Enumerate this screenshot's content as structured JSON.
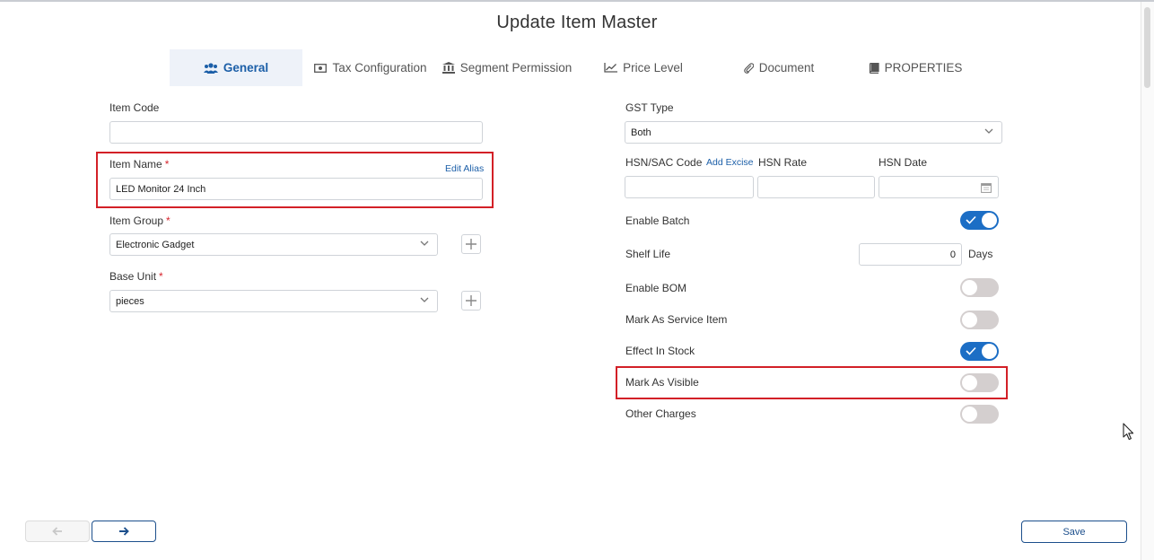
{
  "page": {
    "title": "Update Item Master"
  },
  "tabs": [
    {
      "label": "General",
      "icon": "users-icon",
      "active": true
    },
    {
      "label": "Tax Configuration",
      "icon": "money-icon"
    },
    {
      "label": "Segment Permission",
      "icon": "bank-icon"
    },
    {
      "label": "Price Level",
      "icon": "line-chart-icon"
    },
    {
      "label": "Document",
      "icon": "paperclip-icon"
    },
    {
      "label": "PROPERTIES",
      "icon": "book-icon"
    }
  ],
  "left": {
    "item_code": {
      "label": "Item Code",
      "value": ""
    },
    "item_name": {
      "label": "Item Name",
      "required": "*",
      "value": "LED Monitor 24 Inch",
      "edit_alias": "Edit Alias"
    },
    "item_group": {
      "label": "Item Group",
      "required": "*",
      "value": "Electronic Gadget"
    },
    "base_unit": {
      "label": "Base Unit",
      "required": "*",
      "value": "pieces"
    }
  },
  "right": {
    "gst_type": {
      "label": "GST Type",
      "value": "Both"
    },
    "hsn_sac_code": {
      "label": "HSN/SAC Code",
      "add_excise": "Add Excise",
      "value": ""
    },
    "hsn_rate": {
      "label": "HSN Rate",
      "value": ""
    },
    "hsn_date": {
      "label": "HSN Date",
      "value": ""
    },
    "enable_batch": {
      "label": "Enable Batch",
      "on": true
    },
    "shelf_life": {
      "label": "Shelf Life",
      "value": "0",
      "unit": "Days"
    },
    "enable_bom": {
      "label": "Enable BOM",
      "on": false
    },
    "mark_as_service_item": {
      "label": "Mark As Service Item",
      "on": false
    },
    "effect_in_stock": {
      "label": "Effect In Stock",
      "on": true
    },
    "mark_as_visible": {
      "label": "Mark As Visible",
      "on": false
    },
    "other_charges": {
      "label": "Other Charges",
      "on": false
    }
  },
  "footer": {
    "save_label": "Save"
  },
  "colors": {
    "accent": "#1c6ec5",
    "highlight": "#d32027",
    "toggle_off": "#d4cfcf",
    "required": "#d7262e"
  }
}
